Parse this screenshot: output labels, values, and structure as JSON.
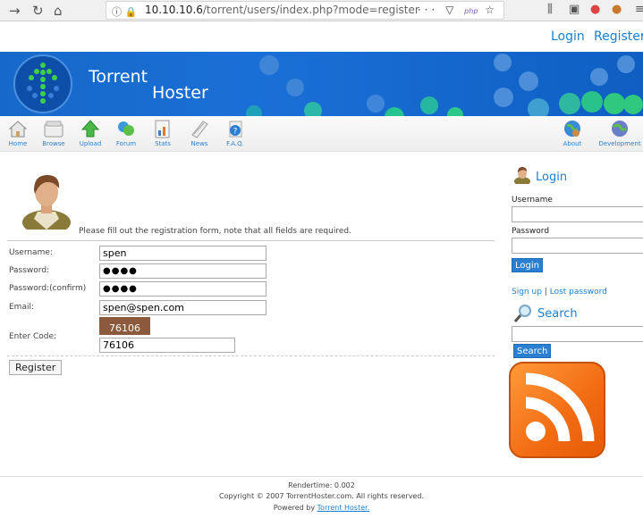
{
  "browser": {
    "url_host": "10.10.10.6",
    "url_path": "/torrent/users/index.php?mode=register",
    "url_badge": "php"
  },
  "toplinks": {
    "login": "Login",
    "register": "Register"
  },
  "header": {
    "name_line1": "Torrent",
    "name_line2": "Hoster"
  },
  "nav": [
    {
      "label": "Home"
    },
    {
      "label": "Browse"
    },
    {
      "label": "Upload"
    },
    {
      "label": "Forum"
    },
    {
      "label": "Stats"
    },
    {
      "label": "News"
    },
    {
      "label": "F.A.Q."
    },
    {
      "label": "About"
    },
    {
      "label": "Development"
    }
  ],
  "form": {
    "intro": "Please fill out the registration form, note that all fields are required.",
    "username_label": "Username:",
    "username_value": "spen",
    "password_label": "Password:",
    "password_value": "●●●●",
    "confirm_label": "Password:(confirm)",
    "confirm_value": "●●●●",
    "email_label": "Email:",
    "email_value": "spen@spen.com",
    "code_label": "Enter Code:",
    "captcha_text": "76106",
    "code_value": "76106",
    "submit": "Register"
  },
  "sidebar": {
    "login_title": "Login",
    "username_label": "Username",
    "password_label": "Password",
    "login_button": "Login",
    "signup": "Sign up",
    "separator": "|",
    "lost_password": "Lost password",
    "search_title": "Search",
    "search_button": "Search"
  },
  "footer": {
    "rendertime": "Rendertime: 0.002",
    "copyright": "Copyright © 2007 TorrentHoster.com. All rights reserved.",
    "powered_prefix": "Powered by",
    "powered_link": "Torrent Hoster."
  }
}
